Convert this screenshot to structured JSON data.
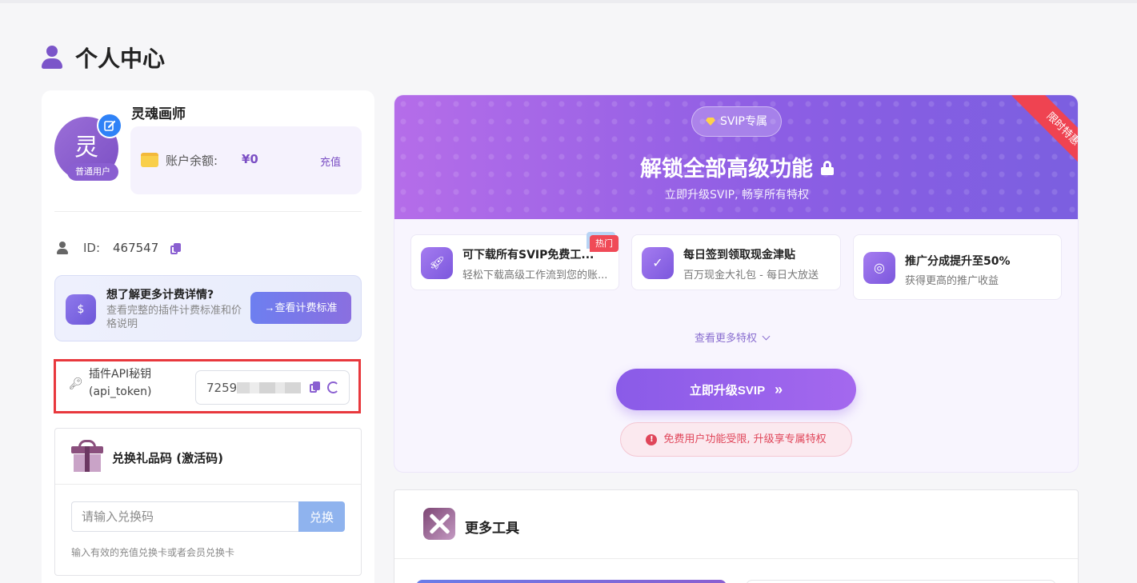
{
  "page": {
    "title": "个人中心"
  },
  "profile": {
    "avatar_text": "灵",
    "user_level": "普通用户",
    "username": "灵魂画师",
    "balance_label": "账户余额:",
    "balance_value": "¥0",
    "recharge_label": "充值",
    "id_label": "ID:",
    "id_value": "467547"
  },
  "pricing": {
    "title": "想了解更多计费详情?",
    "description": "查看完整的插件计费标准和价格说明",
    "button_label": "→查看计费标准",
    "icon_glyph": "$"
  },
  "api": {
    "label": "插件API秘钥 (api_token)",
    "value_prefix": "7259"
  },
  "gift": {
    "title": "兑换礼品码 (激活码)",
    "placeholder": "请输入兑换码",
    "button_label": "兑换",
    "hint": "输入有效的充值兑换卡或者会员兑换卡"
  },
  "vip": {
    "badge": "SVIP专属",
    "title": "解锁全部高级功能",
    "subtitle": "立即升级SVIP, 畅享所有特权",
    "ribbon": "限时特惠",
    "features": [
      {
        "title": "可下载所有SVIP免费工...",
        "desc": "轻松下载高级工作流到您的账...",
        "tag": "热门",
        "icon": "rocket-icon"
      },
      {
        "title": "每日签到领取现金津贴",
        "desc": "百万现金大礼包 - 每日大放送",
        "icon": "calendar-check-icon"
      },
      {
        "title": "推广分成提升至50%",
        "desc": "获得更高的推广收益",
        "icon": "coins-icon"
      }
    ],
    "more_label": "查看更多特权",
    "upgrade_label": "立即升级SVIP",
    "notice": "免费用户功能受限, 升级享专属特权"
  },
  "tools": {
    "title": "更多工具"
  },
  "colors": {
    "accent": "#8a5fd1",
    "brand_gradient_start": "#b56de9",
    "brand_gradient_end": "#7b5fe0",
    "warning": "#e0465a",
    "highlight_outline": "#e8383d"
  }
}
